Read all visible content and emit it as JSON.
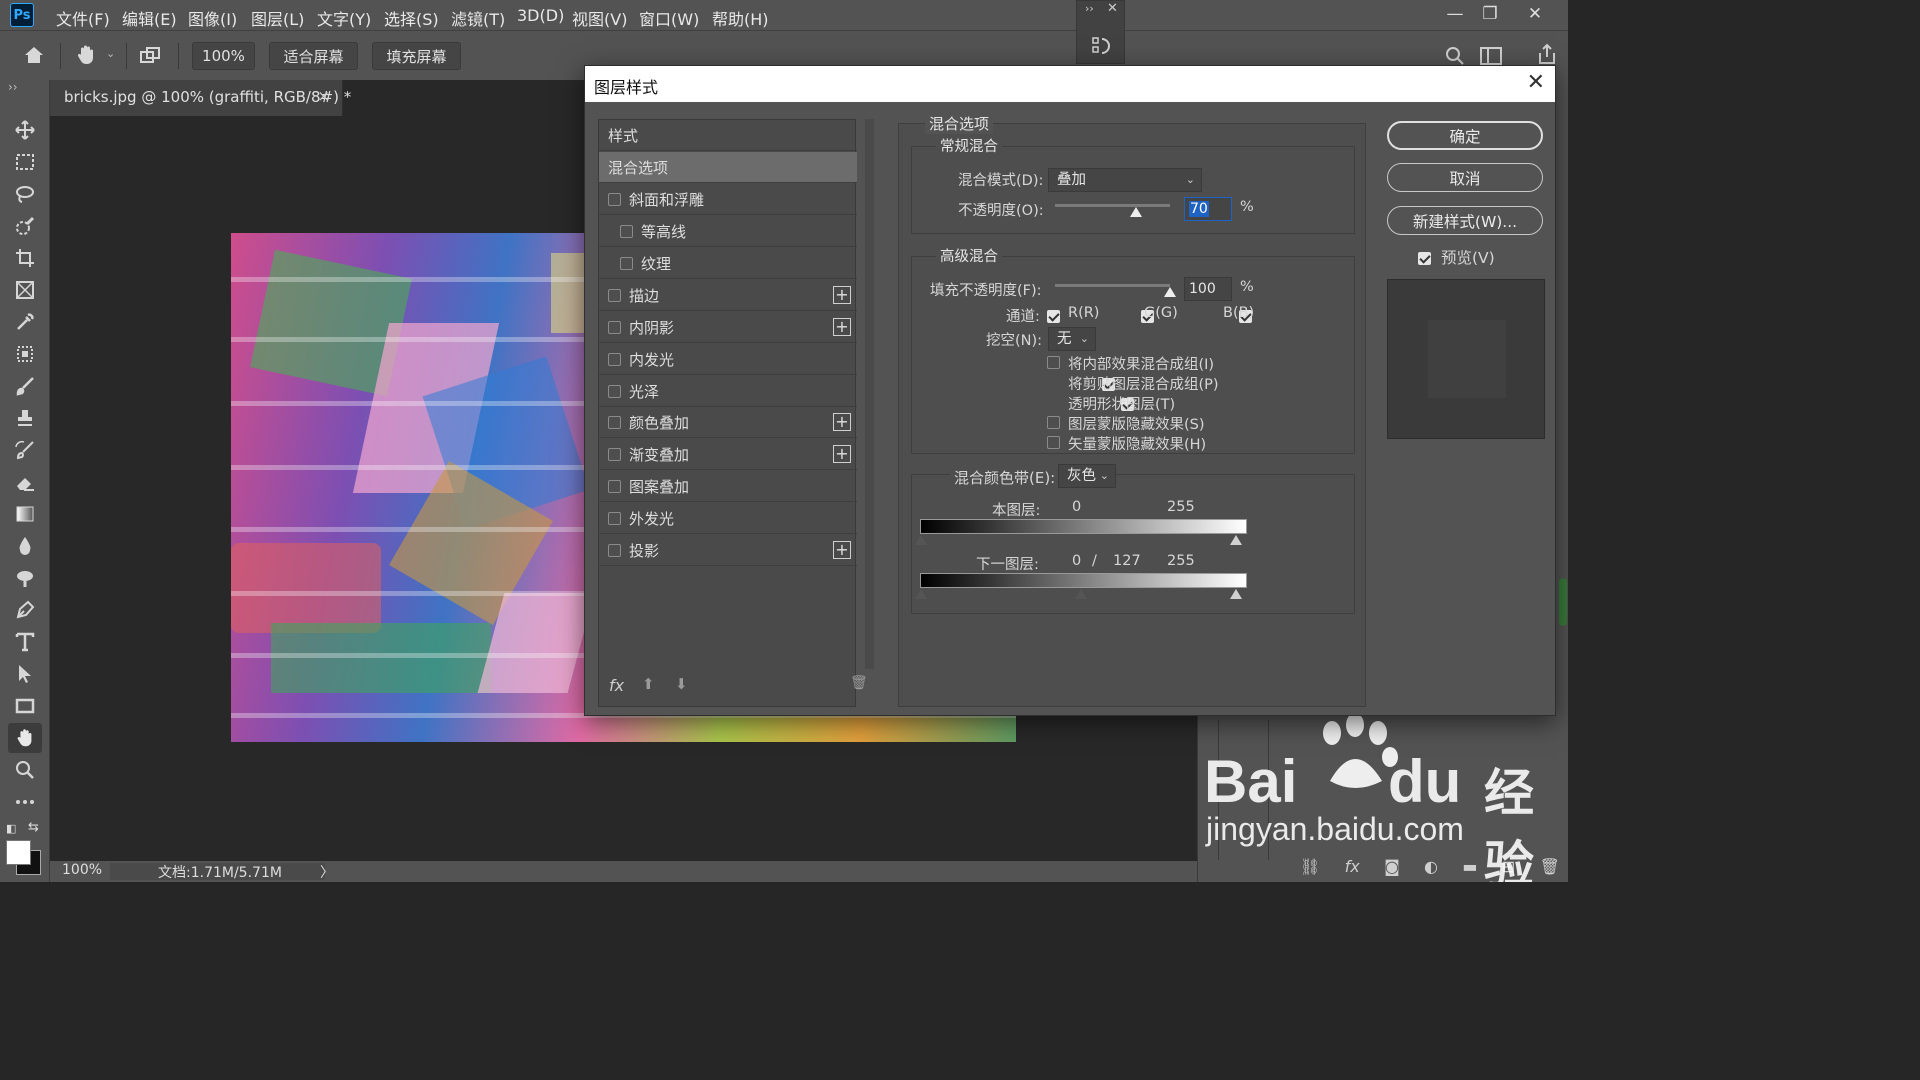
{
  "app": {
    "logo": "Ps"
  },
  "menu": [
    "文件(F)",
    "编辑(E)",
    "图像(I)",
    "图层(L)",
    "文字(Y)",
    "选择(S)",
    "滤镜(T)",
    "3D(D)",
    "视图(V)",
    "窗口(W)",
    "帮助(H)"
  ],
  "options_bar": {
    "zoom": "100%",
    "fit_screen": "适合屏幕",
    "fill_screen": "填充屏幕"
  },
  "document": {
    "tab_title": "bricks.jpg @ 100% (graffiti, RGB/8#) *",
    "close_glyph": "×"
  },
  "status_bar": {
    "zoom": "100%",
    "doc_info": "文档:1.71M/5.71M",
    "arrow": "〉"
  },
  "dialog": {
    "title": "图层样式",
    "close_glyph": "✕",
    "styles_header": "样式",
    "style_items": [
      {
        "label": "混合选项",
        "active": true,
        "checkbox": false,
        "plus": false,
        "indent": false
      },
      {
        "label": "斜面和浮雕",
        "checkbox": true,
        "checked": false,
        "plus": false,
        "indent": false
      },
      {
        "label": "等高线",
        "checkbox": true,
        "checked": false,
        "plus": false,
        "indent": true
      },
      {
        "label": "纹理",
        "checkbox": true,
        "checked": false,
        "plus": false,
        "indent": true
      },
      {
        "label": "描边",
        "checkbox": true,
        "checked": false,
        "plus": true,
        "indent": false
      },
      {
        "label": "内阴影",
        "checkbox": true,
        "checked": false,
        "plus": true,
        "indent": false
      },
      {
        "label": "内发光",
        "checkbox": true,
        "checked": false,
        "plus": false,
        "indent": false
      },
      {
        "label": "光泽",
        "checkbox": true,
        "checked": false,
        "plus": false,
        "indent": false
      },
      {
        "label": "颜色叠加",
        "checkbox": true,
        "checked": false,
        "plus": true,
        "indent": false
      },
      {
        "label": "渐变叠加",
        "checkbox": true,
        "checked": false,
        "plus": true,
        "indent": false
      },
      {
        "label": "图案叠加",
        "checkbox": true,
        "checked": false,
        "plus": false,
        "indent": false
      },
      {
        "label": "外发光",
        "checkbox": true,
        "checked": false,
        "plus": false,
        "indent": false
      },
      {
        "label": "投影",
        "checkbox": true,
        "checked": false,
        "plus": true,
        "indent": false
      }
    ],
    "footer_fx": "fx",
    "blend_options": {
      "section_title": "混合选项",
      "general_title": "常规混合",
      "blend_mode_label": "混合模式(D):",
      "blend_mode_value": "叠加",
      "opacity_label": "不透明度(O):",
      "opacity_value": "70",
      "opacity_fraction": 0.7,
      "percent": "%",
      "advanced_title": "高级混合",
      "fill_opacity_label": "填充不透明度(F):",
      "fill_opacity_value": "100",
      "fill_opacity_fraction": 1.0,
      "channels_label": "通道:",
      "channel_r": "R(R)",
      "channel_g": "G(G)",
      "channel_b": "B(B)",
      "knockout_label": "挖空(N):",
      "knockout_value": "无",
      "option_blend_interior": "将内部效果混合成组(I)",
      "option_blend_clipped": "将剪贴图层混合成组(P)",
      "option_transparency": "透明形状图层(T)",
      "option_layer_mask": "图层蒙版隐藏效果(S)",
      "option_vector_mask": "矢量蒙版隐藏效果(H)",
      "blend_if_label": "混合颜色带(E):",
      "blend_if_value": "灰色",
      "this_layer_label": "本图层:",
      "this_layer_min": "0",
      "this_layer_max": "255",
      "underlying_label": "下一图层:",
      "underlying_min": "0",
      "underlying_slash": "/",
      "underlying_mid": "127",
      "underlying_max": "255"
    },
    "buttons": {
      "ok": "确定",
      "cancel": "取消",
      "new_style": "新建样式(W)...",
      "preview": "预览(V)"
    }
  },
  "watermark": {
    "brand": "Bai",
    "brand2": "du",
    "cn": "经验",
    "url": "jingyan.baidu.com"
  }
}
